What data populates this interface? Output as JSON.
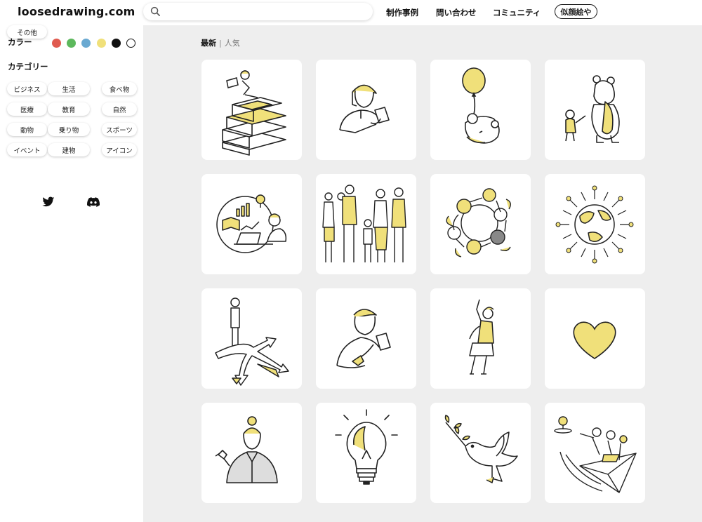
{
  "header": {
    "logo": "loosedrawing.com",
    "search_placeholder": "",
    "nav": [
      "制作事例",
      "問い合わせ",
      "コミュニティ"
    ],
    "pill": "似顔絵や"
  },
  "sidebar": {
    "color_title": "カラー",
    "colors": [
      "#e05a4f",
      "#5cb85c",
      "#6aa9d1",
      "#f0e07a",
      "#111111",
      "#ffffff"
    ],
    "category_title": "カテゴリー",
    "categories": [
      "ビジネス",
      "生活",
      "食べ物",
      "医療",
      "教育",
      "自然",
      "動物",
      "乗り物",
      "スポーツ",
      "イベント",
      "建物",
      "アイコン",
      "その他"
    ],
    "social": [
      "twitter-icon",
      "discord-icon"
    ]
  },
  "main": {
    "sort_latest": "最新",
    "sort_popular": "人気",
    "cards": [
      "books-reading",
      "smartphone-woman",
      "balloon-bear",
      "bear-and-friend",
      "data-analysis",
      "family-group",
      "kids-circle",
      "earth-circle",
      "crossroad-arrows",
      "smartphone-man",
      "cheering-woman",
      "heart",
      "business-woman",
      "light-bulb",
      "dove-olive",
      "paper-plane-team"
    ],
    "accent": "#f0e07a"
  }
}
